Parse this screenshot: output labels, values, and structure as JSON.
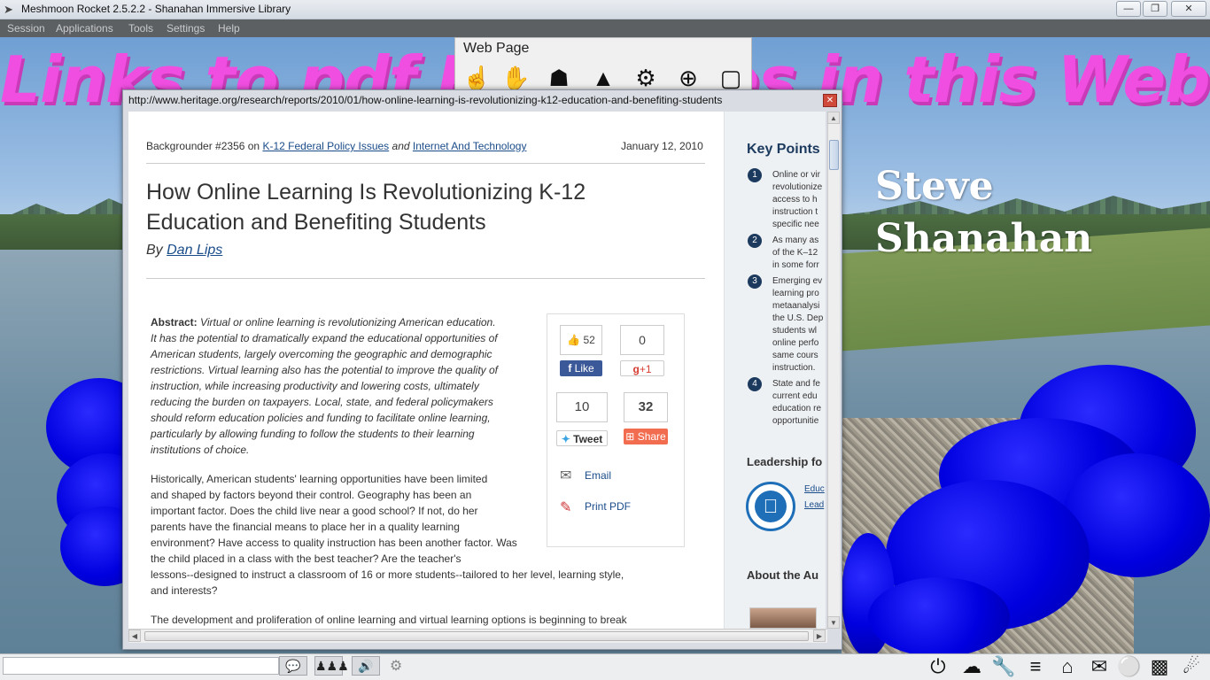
{
  "window": {
    "title": "Meshmoon Rocket 2.5.2.2 - Shanahan Immersive Library",
    "menu": [
      "Session",
      "Applications",
      "Tools",
      "Settings",
      "Help"
    ]
  },
  "scene": {
    "banner_text": "Links to pdf Resources in this Web L",
    "name_line1": "Steve",
    "name_line2": "Shanahan"
  },
  "webpage_widget": {
    "title": "Web Page"
  },
  "browser": {
    "url": "http://www.heritage.org/research/reports/2010/01/how-online-learning-is-revolutionizing-k12-education-and-benefiting-students",
    "article": {
      "backgrounder": "Backgrounder #2356 on",
      "topic1": "K-12 Federal Policy Issues",
      "and": "and",
      "topic2": "Internet And Technology",
      "date": "January 12, 2010",
      "headline": "How Online Learning Is Revolutionizing K-12 Education and Benefiting Students",
      "by": "By",
      "author": "Dan Lips",
      "abstract_label": "Abstract:",
      "abstract_lines": [
        "Virtual or online learning is revolutionizing American education.",
        "It has the potential to dramatically expand the educational opportunities of",
        "American students, largely overcoming the geographic and demographic",
        "restrictions. Virtual learning also has the potential to improve the quality of",
        "instruction, while increasing productivity and lowering costs, ultimately",
        "reducing the burden on taxpayers. Local, state, and federal policymakers",
        "should reform education policies and funding to facilitate online learning,",
        "particularly by allowing funding to follow the students to their learning",
        "institutions of choice."
      ],
      "para1_lines": [
        "Historically, American students' learning opportunities have been limited",
        "and shaped by factors beyond their control. Geography has been an",
        "important factor. Does the child live near a good school? If not, do her",
        "parents have the financial means to place her in a quality learning",
        "environment? Have access to quality instruction has been another factor. Was",
        "the child placed in a class with the best teacher? Are the teacher's",
        "lessons--designed to instruct a classroom of 16 or more students--tailored to her level, learning style,",
        "and interests?"
      ],
      "para2": "The development and proliferation of online learning and virtual learning options is beginning to break"
    },
    "share": {
      "like_count": "52",
      "like_label": "Like",
      "gplus_count": "0",
      "gplus_label": "+1",
      "tweet_count": "10",
      "tweet_label": "Tweet",
      "share_count": "32",
      "share_label": "Share",
      "email_label": "Email",
      "pdf_label": "Print PDF"
    },
    "sidebar": {
      "key_points_title": "Key Points",
      "points": [
        {
          "num": "1",
          "text": "Online or vir\nrevolutionize\naccess to h\ninstruction t\nspecific nee"
        },
        {
          "num": "2",
          "text": "As many as\nof the K–12\nin some forr"
        },
        {
          "num": "3",
          "text": "Emerging ev\nlearning pro\nmetaanalysi\nthe U.S. Dep\nstudents wl\nonline perfo\nsame cours\ninstruction."
        },
        {
          "num": "4",
          "text": "State and fe\ncurrent edu\neducation re\nopportunitie"
        }
      ],
      "leadership_heading": "Leadership fo",
      "leadership_link1": "Educ",
      "leadership_link2": "Lead",
      "about_heading": "About the Au"
    }
  },
  "bottombar": {
    "chat_placeholder": ""
  }
}
